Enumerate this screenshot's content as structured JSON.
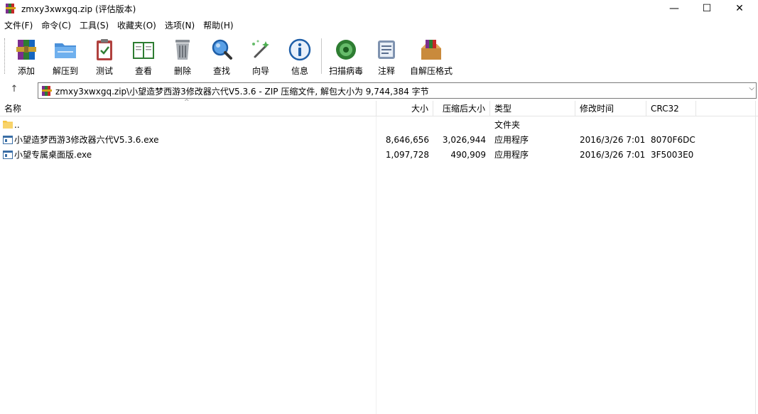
{
  "window": {
    "title": "zmxy3xwxgq.zip (评估版本)",
    "minimize_glyph": "—",
    "maximize_glyph": "☐",
    "close_glyph": "✕"
  },
  "menu": [
    {
      "label": "文件(F)"
    },
    {
      "label": "命令(C)"
    },
    {
      "label": "工具(S)"
    },
    {
      "label": "收藏夹(O)"
    },
    {
      "label": "选项(N)"
    },
    {
      "label": "帮助(H)"
    }
  ],
  "toolbar": [
    {
      "label": "添加",
      "icon": "add-archive-icon"
    },
    {
      "label": "解压到",
      "icon": "extract-folder-icon"
    },
    {
      "label": "测试",
      "icon": "test-clipboard-icon"
    },
    {
      "label": "查看",
      "icon": "view-book-icon"
    },
    {
      "label": "删除",
      "icon": "trash-icon"
    },
    {
      "label": "查找",
      "icon": "magnifier-icon"
    },
    {
      "label": "向导",
      "icon": "wizard-wand-icon"
    },
    {
      "label": "信息",
      "icon": "info-icon"
    },
    {
      "label": "扫描病毒",
      "icon": "virus-scan-icon"
    },
    {
      "label": "注释",
      "icon": "comment-icon"
    },
    {
      "label": "自解压格式",
      "icon": "sfx-box-icon"
    }
  ],
  "address": {
    "up_glyph": "↑",
    "path": "zmxy3xwxgq.zip\\小望造梦西游3修改器六代V5.3.6 - ZIP 压缩文件, 解包大小为 9,744,384 字节",
    "dropdown_glyph": "⌵"
  },
  "columns": {
    "name": "名称",
    "size": "大小",
    "packed": "压缩后大小",
    "type": "类型",
    "modified": "修改时间",
    "crc": "CRC32",
    "sort_glyph": "^"
  },
  "files": [
    {
      "name": "..",
      "size": "",
      "packed": "",
      "type": "文件夹",
      "modified": "",
      "crc": "",
      "icon": "folder-icon"
    },
    {
      "name": "小望造梦西游3修改器六代V5.3.6.exe",
      "size": "8,646,656",
      "packed": "3,026,944",
      "type": "应用程序",
      "modified": "2016/3/26 7:01",
      "crc": "8070F6DC",
      "icon": "exe-icon"
    },
    {
      "name": "小望专属桌面版.exe",
      "size": "1,097,728",
      "packed": "490,909",
      "type": "应用程序",
      "modified": "2016/3/26 7:01",
      "crc": "3F5003E0",
      "icon": "exe-icon"
    }
  ],
  "colors": {
    "accent": "#0078d7",
    "folder": "#f5c542"
  }
}
